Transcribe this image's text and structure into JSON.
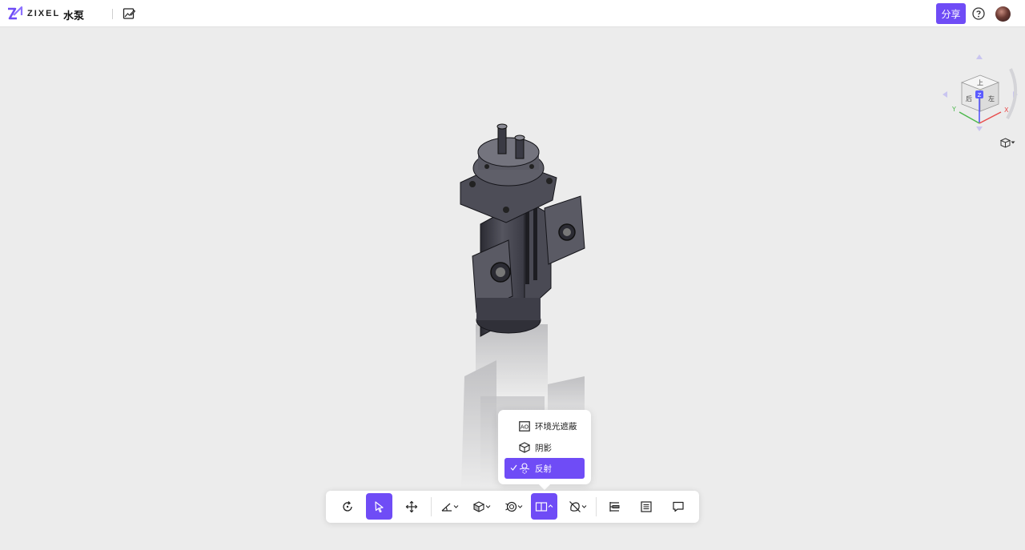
{
  "app": {
    "logo_text": "ZIXEL",
    "document_title": "水泵"
  },
  "header": {
    "share_label": "分享"
  },
  "view_cube": {
    "faces": {
      "top": "上",
      "front": "后",
      "right": "左"
    },
    "axes": {
      "x": "X",
      "y": "Y",
      "z": "Z"
    }
  },
  "render_menu": {
    "items": [
      {
        "label": "环境光遮蔽",
        "icon": "ao-icon",
        "active": false
      },
      {
        "label": "阴影",
        "icon": "shadow-cube-icon",
        "active": false
      },
      {
        "label": "反射",
        "icon": "reflection-icon",
        "active": true
      }
    ]
  },
  "toolbar": {
    "buttons": [
      {
        "name": "rotate-tool",
        "icon": "rotate-icon",
        "active": false
      },
      {
        "name": "select-tool",
        "icon": "cursor-icon",
        "active": true
      },
      {
        "name": "pan-tool",
        "icon": "move-icon",
        "active": false
      },
      {
        "name": "measure-tool",
        "icon": "measure-icon",
        "active": false
      },
      {
        "name": "view-mode-tool",
        "icon": "cube-view-icon",
        "active": false
      },
      {
        "name": "explode-tool",
        "icon": "explode-icon",
        "active": false
      },
      {
        "name": "render-tool",
        "icon": "render-panel-icon",
        "active": true
      },
      {
        "name": "section-tool",
        "icon": "section-icon",
        "active": false
      },
      {
        "name": "model-tree-tool",
        "icon": "tree-icon",
        "active": false
      },
      {
        "name": "properties-tool",
        "icon": "properties-icon",
        "active": false
      },
      {
        "name": "comment-tool",
        "icon": "comment-icon",
        "active": false
      }
    ]
  },
  "colors": {
    "accent": "#6f4cf6",
    "background": "#ececec"
  }
}
